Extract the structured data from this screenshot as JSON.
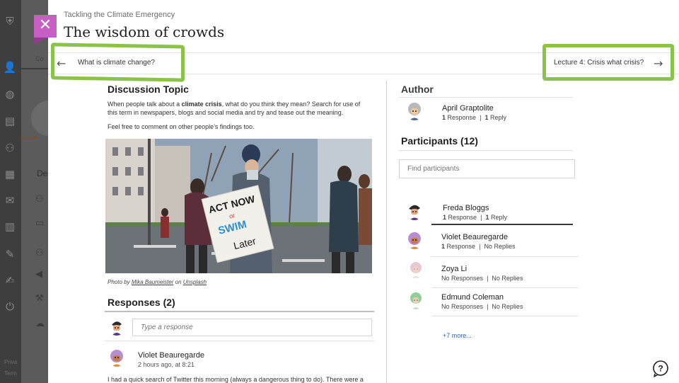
{
  "background": {
    "tab_label": "Co",
    "section_text": "De",
    "footer_lines": [
      "Priva",
      "Term"
    ]
  },
  "header": {
    "course_label": "Tackling the Climate Emergency",
    "title": "The wisdom of crowds",
    "close_icon": "close-icon"
  },
  "navigation": {
    "previous_label": "What is climate change?",
    "next_label": "Lecture 4: Crisis what crisis?",
    "previous_icon": "arrow-left-icon",
    "next_icon": "arrow-right-icon",
    "highlight_color": "#8bc34a"
  },
  "topic": {
    "heading": "Discussion Topic",
    "body_pre": "When people talk about a ",
    "body_bold": "climate crisis",
    "body_post": ", what do you think they mean? Search for use of this term in newspapers, blogs and social media and try and tease out the meaning.",
    "note": "Feel free to comment on other people’s findings too.",
    "photo_sign_lines": [
      "ACT NOW",
      "or",
      "SWIM",
      "Later"
    ],
    "caption_pre": "Photo by ",
    "caption_author": "Mika Baumeister",
    "caption_mid": " on ",
    "caption_site": "Unsplash"
  },
  "responses": {
    "heading": "Responses (2)",
    "input_placeholder": "Type a response",
    "first_post": {
      "author": "Violet Beauregarde",
      "time": "2 hours ago, at 8:21",
      "body": "I had a quick search of Twitter this morning (always a dangerous thing to do). There were a"
    }
  },
  "author": {
    "heading": "Author",
    "name": "April Graptolite",
    "responses_count": "1",
    "responses_label": "Response",
    "replies_count": "1",
    "replies_label": "Reply"
  },
  "participants": {
    "heading": "Participants (12)",
    "search_placeholder": "Find participants",
    "separator": "|",
    "people": [
      {
        "name": "Freda Bloggs",
        "left_count": "1",
        "left_label": "Response",
        "right_count": "1",
        "right_label": "Reply"
      },
      {
        "name": "Violet Beauregarde",
        "left_count": "1",
        "left_label": "Response",
        "right_count": "",
        "right_label": "No Replies"
      },
      {
        "name": "Zoya Li",
        "left_count": "",
        "left_label": "No Responses",
        "right_count": "",
        "right_label": "No Replies"
      },
      {
        "name": "Edmund Coleman",
        "left_count": "",
        "left_label": "No Responses",
        "right_count": "",
        "right_label": "No Replies"
      }
    ],
    "more_label": "+7 more..."
  },
  "colors": {
    "close_button": "#c75ec4",
    "link": "#2b67b3"
  }
}
